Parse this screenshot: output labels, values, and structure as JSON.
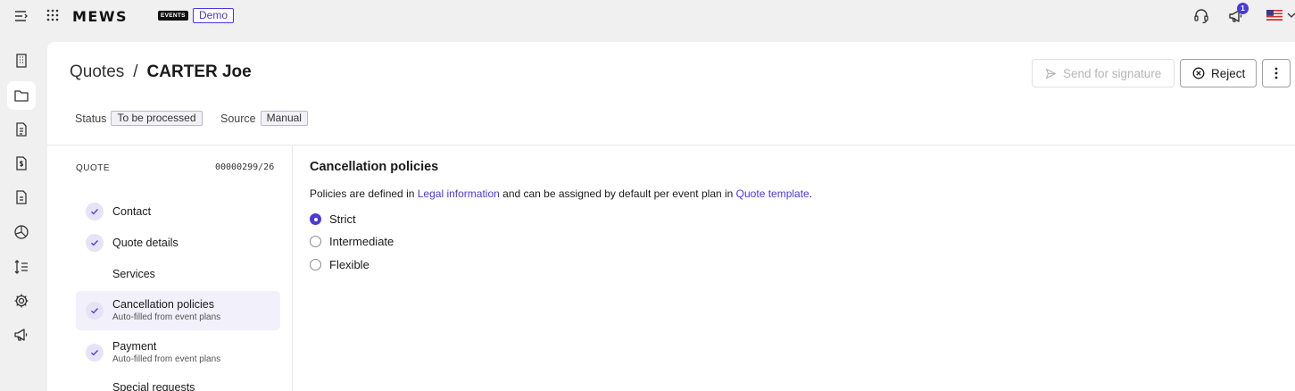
{
  "topbar": {
    "logo": "MEWS",
    "events_badge": "EVENTS",
    "demo_badge": "Demo",
    "notification_count": "1"
  },
  "breadcrumb": {
    "parent": "Quotes",
    "separator": "/",
    "current": "CARTER Joe"
  },
  "actions": {
    "send_label": "Send for signature",
    "reject_label": "Reject"
  },
  "meta": {
    "status_label": "Status",
    "status_value": "To be processed",
    "source_label": "Source",
    "source_value": "Manual"
  },
  "sidebar": {
    "quote_label": "QUOTE",
    "quote_number": "00000299/26",
    "steps": [
      {
        "title": "Contact",
        "sub": "",
        "done": true
      },
      {
        "title": "Quote details",
        "sub": "",
        "done": true
      },
      {
        "title": "Services",
        "sub": "",
        "done": false
      },
      {
        "title": "Cancellation policies",
        "sub": "Auto-filled from event plans",
        "done": true
      },
      {
        "title": "Payment",
        "sub": "Auto-filled from event plans",
        "done": true
      },
      {
        "title": "Special requests",
        "sub": "",
        "done": false
      }
    ]
  },
  "content": {
    "title": "Cancellation policies",
    "text_1": "Policies are defined in ",
    "link_1": "Legal information",
    "text_2": " and can be assigned by default per event plan in ",
    "link_2": "Quote template",
    "text_3": ".",
    "options": [
      {
        "label": "Strict",
        "selected": true
      },
      {
        "label": "Intermediate",
        "selected": false
      },
      {
        "label": "Flexible",
        "selected": false
      }
    ]
  },
  "colors": {
    "accent": "#4a3ad8",
    "background": "#f0f0f0",
    "panel": "#ffffff"
  }
}
